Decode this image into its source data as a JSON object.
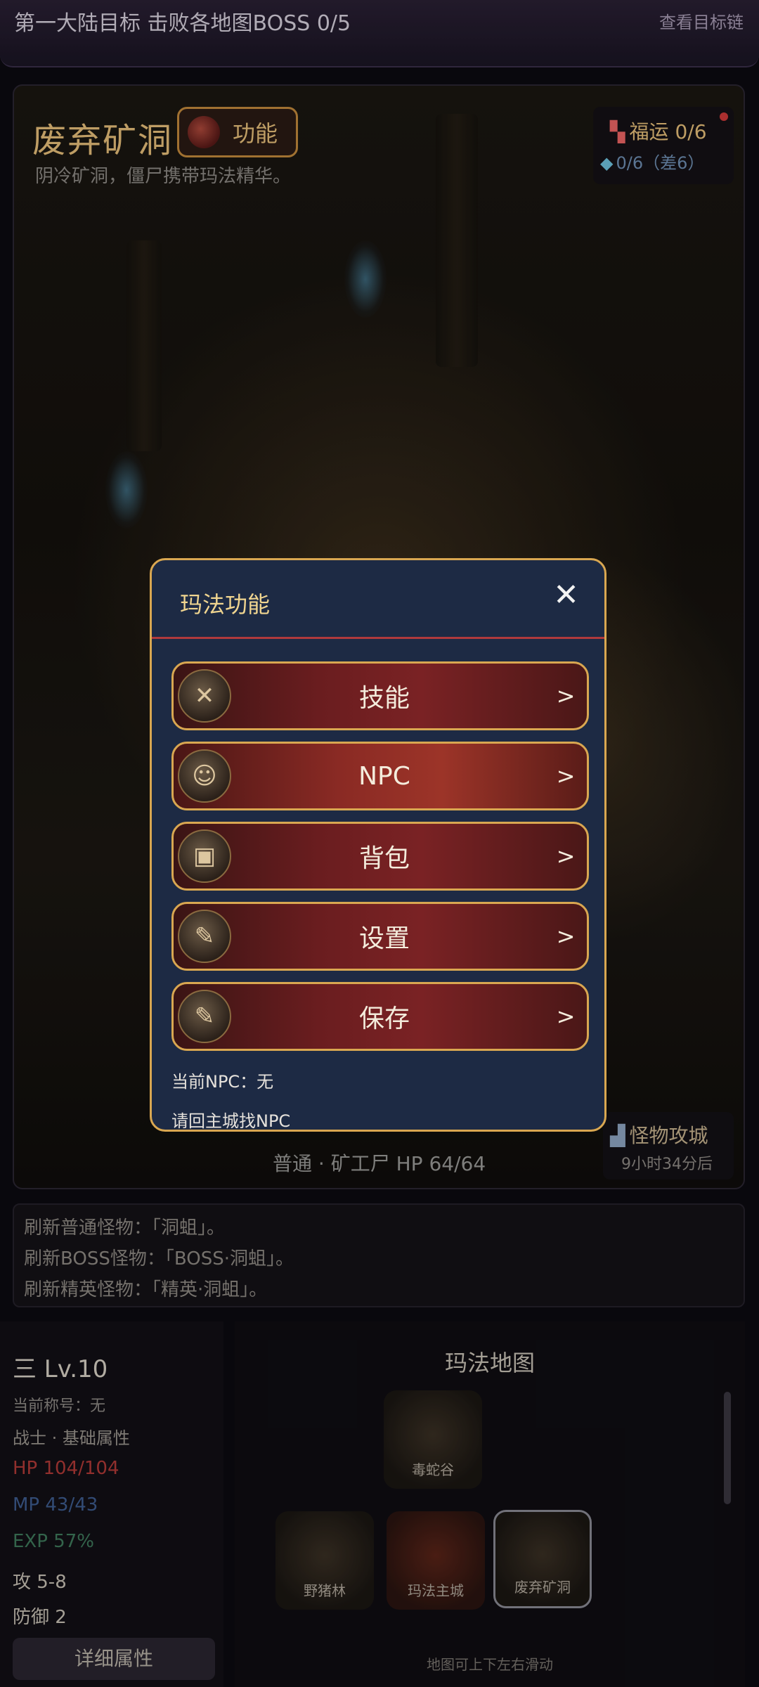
{
  "topbar": {
    "goal_text": "第一大陆目标  击败各地图BOSS 0/5",
    "goal_link": "查看目标链"
  },
  "scene": {
    "map_name": "废弃矿洞",
    "func_label": "功能",
    "map_desc": "阴冷矿洞，僵尸携带玛法精华。",
    "luck_label": "福运 0/6",
    "gem_label": "0/6（差6）",
    "monster_line": "普通 · 矿工尸  HP 64/64",
    "siege_title": "怪物攻城",
    "siege_time": "9小时34分后"
  },
  "modal": {
    "title": "玛法功能",
    "close": "✕",
    "items": [
      {
        "label": "技能",
        "arrow": ">",
        "icon": "crossed-swords-icon",
        "glyph": "✕"
      },
      {
        "label": "NPC",
        "arrow": ">",
        "icon": "npc-portrait-icon",
        "glyph": "☺"
      },
      {
        "label": "背包",
        "arrow": ">",
        "icon": "backpack-icon",
        "glyph": "▣"
      },
      {
        "label": "设置",
        "arrow": ">",
        "icon": "scroll-icon",
        "glyph": "✎"
      },
      {
        "label": "保存",
        "arrow": ">",
        "icon": "scroll-icon",
        "glyph": "✎"
      }
    ],
    "footer_npc": "当前NPC：无",
    "footer_hint": "请回主城找NPC"
  },
  "log": {
    "lines": [
      "刷新普通怪物：「洞蛆」。",
      "刷新BOSS怪物：「BOSS·洞蛆」。",
      "刷新精英怪物：「精英·洞蛆」。"
    ]
  },
  "stats": {
    "level": "三 Lv.10",
    "title": "当前称号：无",
    "class": "战士 · 基础属性",
    "hp": "HP 104/104",
    "mp": "MP 43/43",
    "exp": "EXP 57%",
    "attack": "攻 5-8",
    "defense": "防御 2",
    "detail_button": "详细属性"
  },
  "mappanel": {
    "title": "玛法地图",
    "nodes": [
      "毒蛇谷",
      "野猪林",
      "玛法主城",
      "废弃矿洞"
    ],
    "hint": "地图可上下左右滑动"
  },
  "colors": {
    "accent_gold": "#d9a751",
    "modal_bg": "#1d2a44",
    "hp": "#b13a37",
    "mp": "#3d5c8f",
    "exp": "#3f7a5c"
  }
}
